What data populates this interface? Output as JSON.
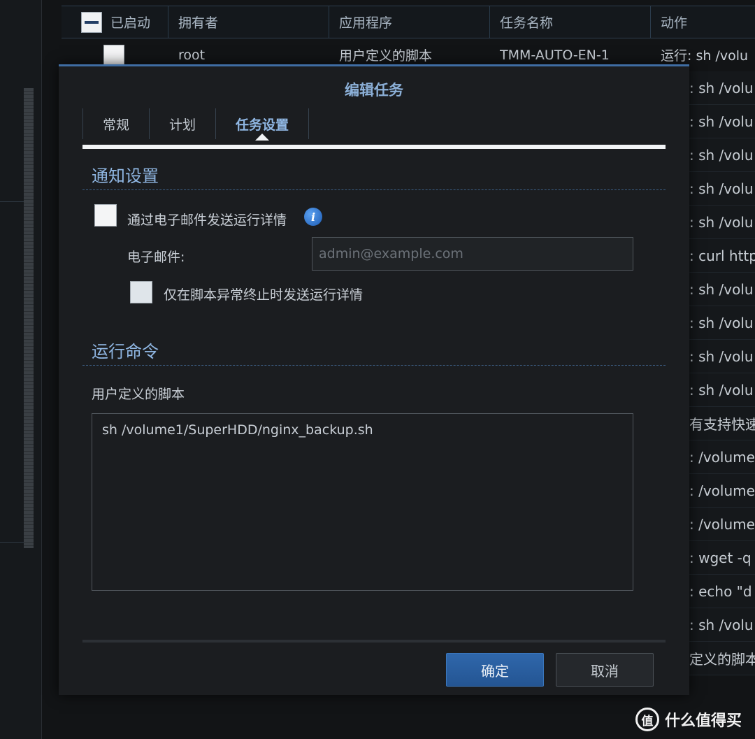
{
  "table": {
    "headers": {
      "enabled": "已启动",
      "owner": "拥有者",
      "app": "应用程序",
      "task": "任务名称",
      "action": "动作"
    },
    "first_row": {
      "owner": "root",
      "app": "用户定义的脚本",
      "task": "TMM-AUTO-EN-1",
      "action": "运行: sh /volu"
    },
    "action_cells": [
      ": sh /volu",
      ": sh /volu",
      ": sh /volu",
      ": sh /volu",
      ": sh /volu",
      ": curl http",
      ": sh /volu",
      ": sh /volu",
      ": sh /volu",
      ": sh /volu",
      "有支持快速",
      ": /volume",
      ": /volume",
      ": /volume",
      ": wget -q",
      ": echo \"d",
      ": sh /volu",
      "定义的脚本"
    ]
  },
  "dialog": {
    "title": "编辑任务",
    "tabs": [
      "常规",
      "计划",
      "任务设置"
    ],
    "notify": {
      "section_title": "通知设置",
      "send_email_label": "通过电子邮件发送运行详情",
      "email_label": "电子邮件:",
      "email_placeholder": "admin@example.com",
      "abnormal_only_label": "仅在脚本异常终止时发送运行详情"
    },
    "run": {
      "section_title": "运行命令",
      "script_label": "用户定义的脚本",
      "script_value": "sh /volume1/SuperHDD/nginx_backup.sh"
    },
    "buttons": {
      "ok": "确定",
      "cancel": "取消"
    }
  },
  "watermark": {
    "logo_char": "值",
    "text": "什么值得买"
  },
  "colors": {
    "accent": "#8fb6e2",
    "primary_button": "#2f67ab",
    "background": "#121416"
  }
}
